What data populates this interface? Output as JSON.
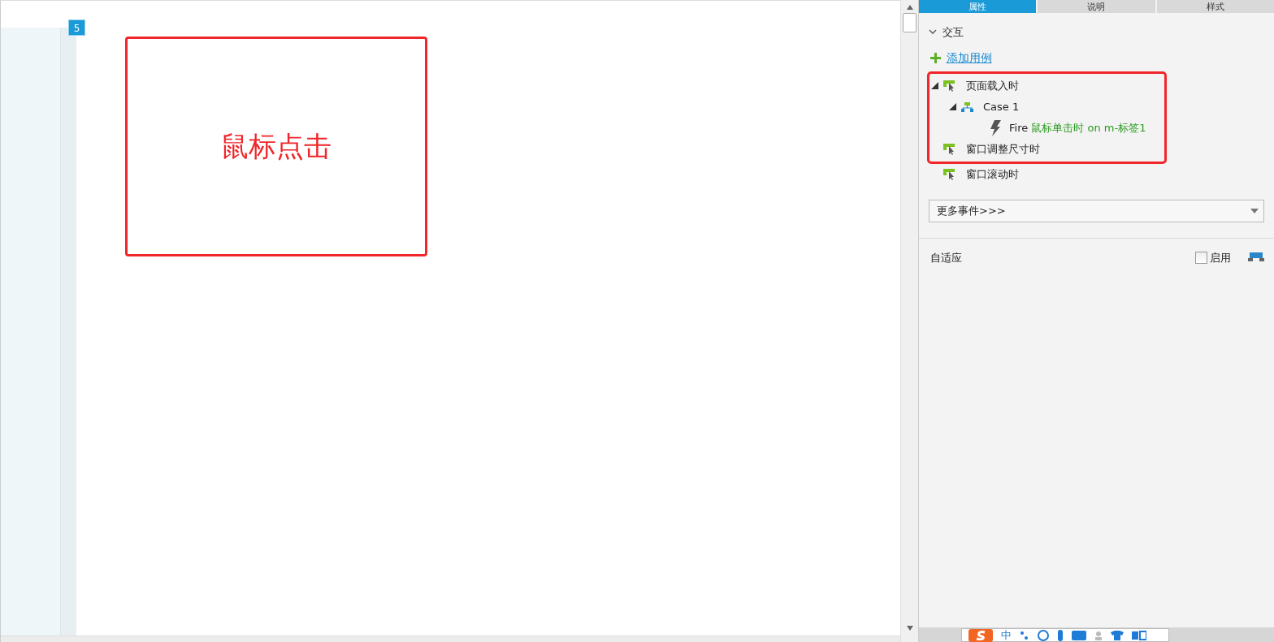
{
  "canvas": {
    "page_badge": "5",
    "widget": {
      "label": "鼠标点击"
    }
  },
  "panel": {
    "tabs": [
      {
        "label": "属性",
        "selected": true
      },
      {
        "label": "说明",
        "selected": false
      },
      {
        "label": "样式",
        "selected": false
      }
    ],
    "section": {
      "title": "交互",
      "expanded": true
    },
    "add_case": "添加用例",
    "events": [
      {
        "label": "页面载入时",
        "highlighted": true,
        "expanded": true,
        "children": [
          {
            "kind": "case",
            "label": "Case 1",
            "expanded": true,
            "children": [
              {
                "kind": "action",
                "action": "Fire",
                "detail": "鼠标单击时 on m-标签1"
              }
            ]
          }
        ]
      },
      {
        "label": "窗口调整尺寸时",
        "highlighted": true
      },
      {
        "label": "窗口滚动时",
        "highlighted": false
      }
    ],
    "more_events": "更多事件>>>",
    "adaptive": {
      "label": "自适应",
      "enable_label": "启用",
      "checked": false
    }
  },
  "ime_bar": {
    "mode": "中"
  }
}
